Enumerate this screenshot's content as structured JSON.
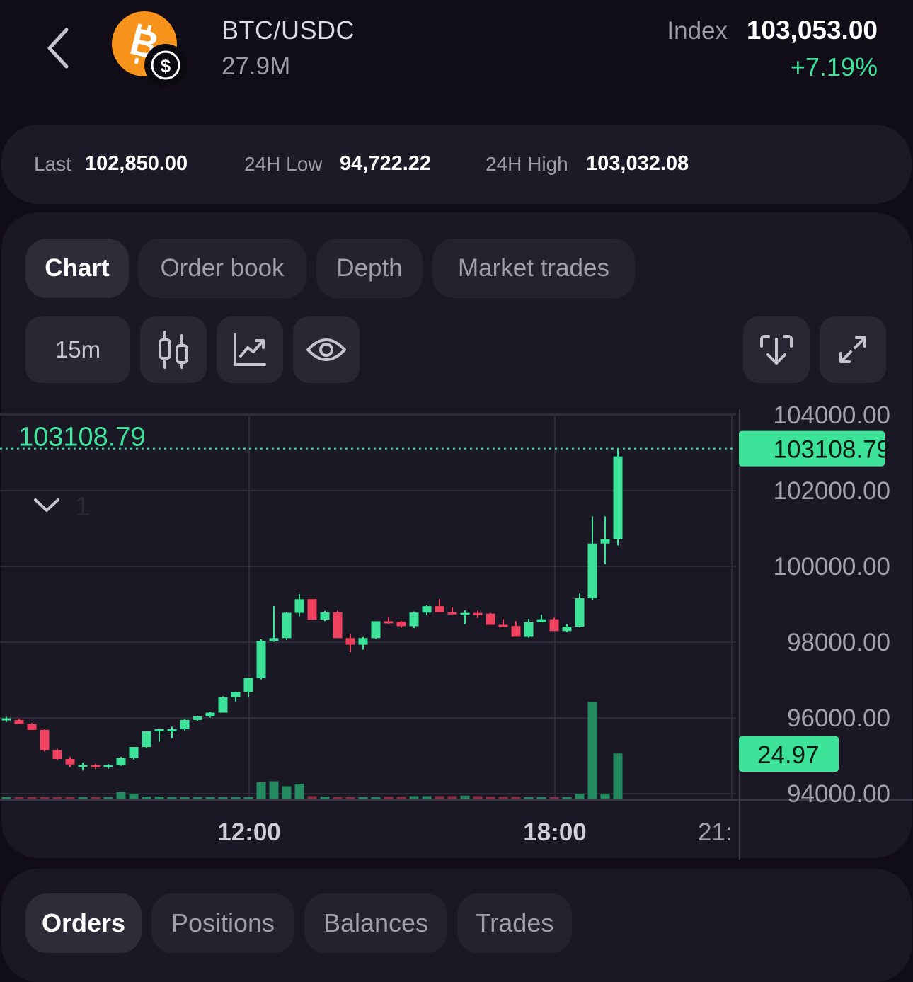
{
  "header": {
    "pair": "BTC/USDC",
    "volume": "27.9M",
    "index_label": "Index",
    "index_value": "103,053.00",
    "change": "+7.19%",
    "coin_icon": "bitcoin-icon",
    "quote_icon": "usdc-icon"
  },
  "stats": {
    "last_label": "Last",
    "last_value": "102,850.00",
    "low_label": "24H Low",
    "low_value": "94,722.22",
    "high_label": "24H High",
    "high_value": "103,032.08"
  },
  "tabs": [
    "Chart",
    "Order book",
    "Depth",
    "Market trades"
  ],
  "toolbar": {
    "timeframe": "15m",
    "icons": [
      "candlestick-icon",
      "line-chart-icon",
      "eye-icon",
      "download-icon",
      "fullscreen-icon"
    ]
  },
  "chart_data": {
    "type": "candlestick",
    "current_price_label": "103108.79",
    "current_price": 103108.79,
    "volume_label": "24.97",
    "indicator_toggle": "1",
    "y_ticks": [
      "104000.00",
      "102000.00",
      "100000.00",
      "98000.00",
      "96000.00",
      "94000.00"
    ],
    "y_tick_values": [
      104000,
      102000,
      100000,
      98000,
      96000,
      94000
    ],
    "x_ticks": [
      "12:00",
      "18:00",
      "21:"
    ],
    "colors": {
      "up": "#3ee39a",
      "down": "#f0415f",
      "grid": "#2e2b39"
    },
    "candles": [
      [
        95934,
        96029,
        95891,
        95989
      ],
      [
        95943,
        95972,
        95838,
        95839
      ],
      [
        95838,
        95862,
        95680,
        95685
      ],
      [
        95685,
        95700,
        95111,
        95149
      ],
      [
        95149,
        95183,
        94882,
        94917
      ],
      [
        94917,
        94968,
        94701,
        94772
      ],
      [
        94762,
        94819,
        94610,
        94762
      ],
      [
        94752,
        94796,
        94647,
        94744
      ],
      [
        94744,
        94785,
        94656,
        94759
      ],
      [
        94759,
        94970,
        94734,
        94941
      ],
      [
        94941,
        95231,
        94902,
        95233
      ],
      [
        95233,
        95653,
        95210,
        95645
      ],
      [
        95645,
        95701,
        95374,
        95701
      ],
      [
        95701,
        95767,
        95463,
        95701
      ],
      [
        95701,
        95960,
        95670,
        95946
      ],
      [
        95946,
        96052,
        95928,
        96037
      ],
      [
        96037,
        96160,
        96012,
        96140
      ],
      [
        96140,
        96572,
        96140,
        96552
      ],
      [
        96552,
        96695,
        96434,
        96687
      ],
      [
        96687,
        97055,
        96558,
        97055
      ],
      [
        97055,
        98075,
        97017,
        98032
      ],
      [
        98032,
        98951,
        98012,
        98107
      ],
      [
        98107,
        98797,
        98055,
        98775
      ],
      [
        98775,
        99264,
        98685,
        99133
      ],
      [
        99137,
        99107,
        98594,
        98594
      ],
      [
        98594,
        98824,
        98557,
        98790
      ],
      [
        98790,
        98832,
        98105,
        98107
      ],
      [
        98107,
        98211,
        97736,
        97933
      ],
      [
        97933,
        98136,
        97802,
        98107
      ],
      [
        98107,
        98553,
        98085,
        98553
      ],
      [
        98553,
        98651,
        98488,
        98540
      ],
      [
        98540,
        98556,
        98383,
        98422
      ],
      [
        98422,
        98812,
        98373,
        98781
      ],
      [
        98781,
        98977,
        98719,
        98950
      ],
      [
        98950,
        99136,
        98819,
        98795
      ],
      [
        98795,
        98922,
        98743,
        98734
      ],
      [
        98734,
        98839,
        98475,
        98773
      ],
      [
        98773,
        98835,
        98640,
        98755
      ],
      [
        98755,
        98772,
        98458,
        98458
      ],
      [
        98458,
        98609,
        98442,
        98427
      ],
      [
        98427,
        98555,
        98149,
        98141
      ],
      [
        98141,
        98614,
        98118,
        98523
      ],
      [
        98523,
        98728,
        98527,
        98605
      ],
      [
        98605,
        98643,
        98342,
        98293
      ],
      [
        98293,
        98477,
        98266,
        98410
      ],
      [
        98410,
        99284,
        98391,
        99158
      ],
      [
        99158,
        101318,
        99118,
        100604
      ],
      [
        100604,
        101319,
        100058,
        100717
      ],
      [
        100717,
        103108,
        100554,
        102904
      ]
    ],
    "volumes": [
      0.3,
      0.3,
      0.3,
      0.3,
      0.3,
      0.3,
      0.3,
      0.3,
      0.3,
      1.3,
      1,
      0.4,
      0.4,
      0.3,
      0.3,
      0.3,
      0.3,
      0.3,
      0.3,
      0.3,
      3.3,
      3.5,
      2.5,
      3,
      0.5,
      0.4,
      0.3,
      0.3,
      0.3,
      0.3,
      0.4,
      0.4,
      0.5,
      0.5,
      0.5,
      0.5,
      0.6,
      0.5,
      0.4,
      0.4,
      0.4,
      0.3,
      0.3,
      0.3,
      0.3,
      1,
      19.5,
      1,
      9.1
    ]
  },
  "bottom_tabs": [
    "Orders",
    "Positions",
    "Balances",
    "Trades"
  ]
}
